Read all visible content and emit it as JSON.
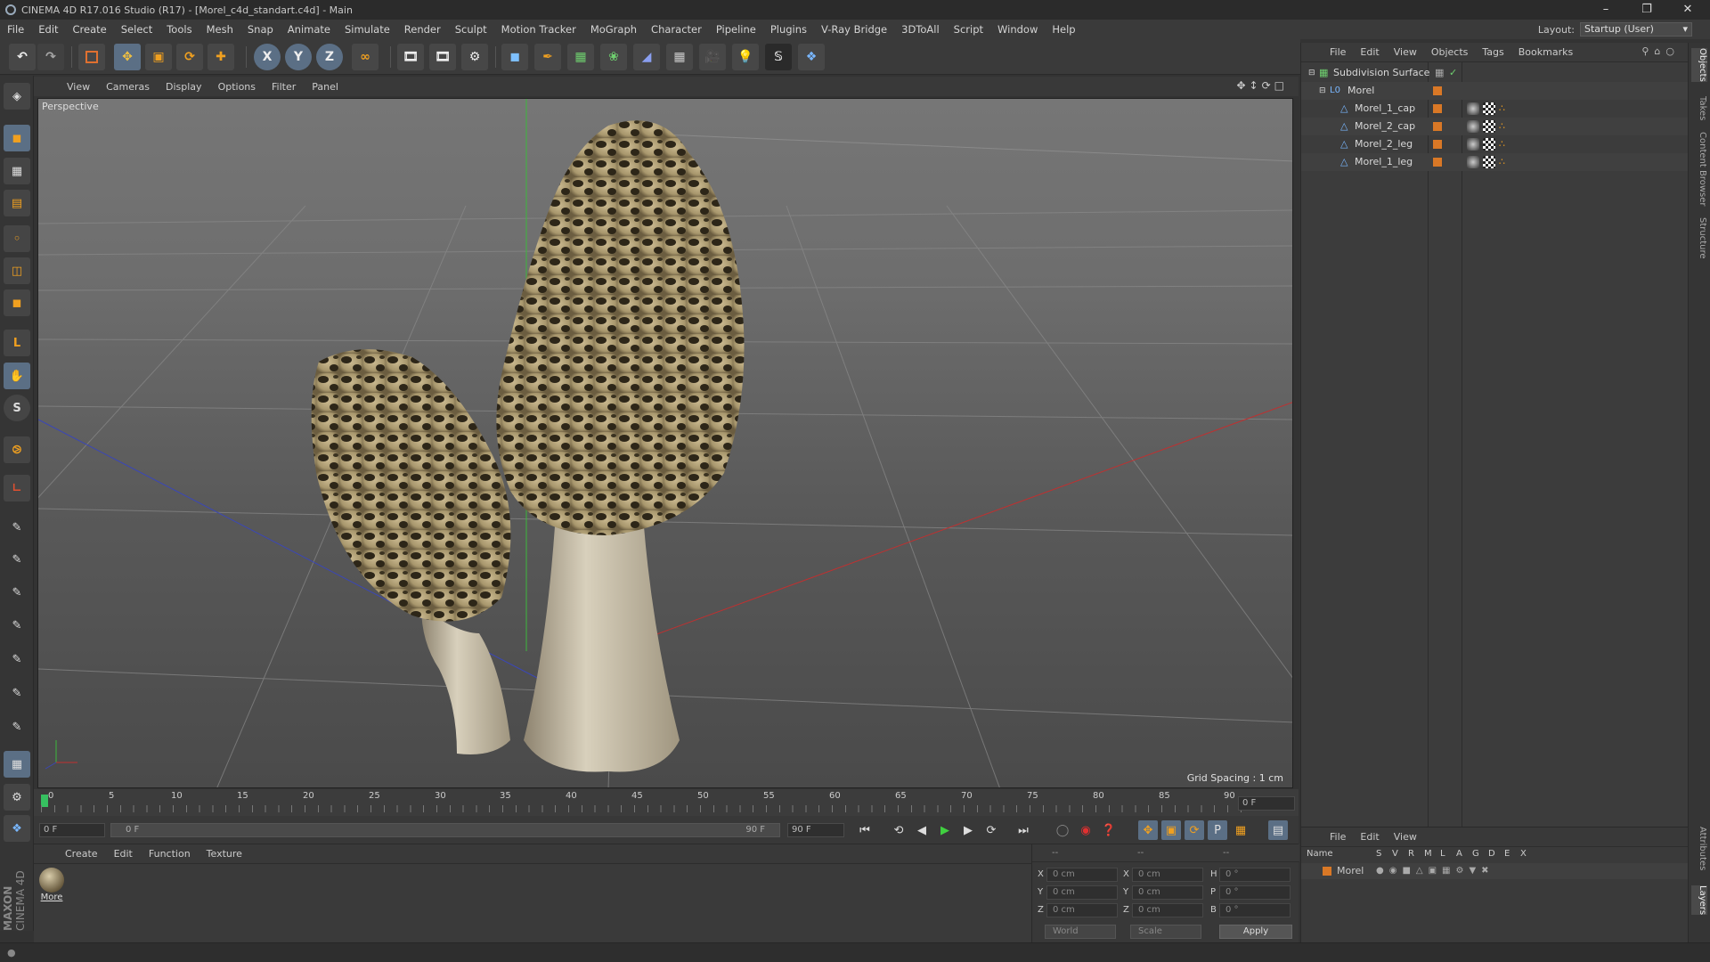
{
  "window": {
    "title": "CINEMA 4D R17.016 Studio (R17) - [Morel_c4d_standart.c4d] - Main"
  },
  "menu": [
    "File",
    "Edit",
    "Create",
    "Select",
    "Tools",
    "Mesh",
    "Snap",
    "Animate",
    "Simulate",
    "Render",
    "Sculpt",
    "Motion Tracker",
    "MoGraph",
    "Character",
    "Pipeline",
    "Plugins",
    "V-Ray Bridge",
    "3DToAll",
    "Script",
    "Window",
    "Help"
  ],
  "layout": {
    "label": "Layout:",
    "value": "Startup (User)"
  },
  "toolbar": {
    "axis_x": "X",
    "axis_y": "Y",
    "axis_z": "Z"
  },
  "viewport": {
    "menu": [
      "View",
      "Cameras",
      "Display",
      "Options",
      "Filter",
      "Panel"
    ],
    "label": "Perspective",
    "grid_spacing": "Grid Spacing : 1 cm"
  },
  "timeline": {
    "ticks": [
      "0",
      "5",
      "10",
      "15",
      "20",
      "25",
      "30",
      "35",
      "40",
      "45",
      "50",
      "55",
      "60",
      "65",
      "70",
      "75",
      "80",
      "85",
      "90"
    ],
    "current_frame": "0 F",
    "start_field": "0 F",
    "range_start": "0 F",
    "range_end": "90 F",
    "end_field": "90 F"
  },
  "material_panel": {
    "menu": [
      "Create",
      "Edit",
      "Function",
      "Texture"
    ],
    "material_name": "More"
  },
  "coords": {
    "header": [
      "--",
      "--",
      "--"
    ],
    "rows": [
      {
        "a": "X",
        "av": "0 cm",
        "b": "X",
        "bv": "0 cm",
        "c": "H",
        "cv": "0 °"
      },
      {
        "a": "Y",
        "av": "0 cm",
        "b": "Y",
        "bv": "0 cm",
        "c": "P",
        "cv": "0 °"
      },
      {
        "a": "Z",
        "av": "0 cm",
        "b": "Z",
        "bv": "0 cm",
        "c": "B",
        "cv": "0 °"
      }
    ],
    "mode": "World",
    "scale": "Scale",
    "apply": "Apply"
  },
  "objects_panel": {
    "menu": [
      "File",
      "Edit",
      "View",
      "Objects",
      "Tags",
      "Bookmarks"
    ],
    "items": [
      {
        "name": "Subdivision Surface",
        "level": 0
      },
      {
        "name": "Morel",
        "level": 1
      },
      {
        "name": "Morel_1_cap",
        "level": 2
      },
      {
        "name": "Morel_2_cap",
        "level": 2
      },
      {
        "name": "Morel_2_leg",
        "level": 2
      },
      {
        "name": "Morel_1_leg",
        "level": 2
      }
    ]
  },
  "layers_panel": {
    "menu": [
      "File",
      "Edit",
      "View"
    ],
    "columns": [
      "Name",
      "S",
      "V",
      "R",
      "M",
      "L",
      "A",
      "G",
      "D",
      "E",
      "X"
    ],
    "layer_name": "Morel"
  },
  "right_tabs": [
    "Objects",
    "Takes",
    "Content Browser",
    "Structure",
    "Attributes",
    "Layers"
  ],
  "brand": {
    "line1": "MAXON",
    "line2": "CINEMA 4D"
  },
  "colors": {
    "accent": "#5b6f85",
    "layer": "#d97826",
    "bg": "#3a3a3a"
  }
}
